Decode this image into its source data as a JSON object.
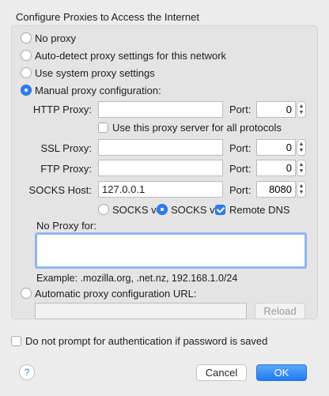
{
  "section_title": "Configure Proxies to Access the Internet",
  "options": {
    "no_proxy": "No proxy",
    "auto_detect": "Auto-detect proxy settings for this network",
    "system": "Use system proxy settings",
    "manual": "Manual proxy configuration:",
    "auto_url": "Automatic proxy configuration URL:"
  },
  "selected_option": "manual",
  "http": {
    "label": "HTTP Proxy:",
    "value": "",
    "port_label": "Port:",
    "port": "0"
  },
  "use_for_all": {
    "label": "Use this proxy server for all protocols",
    "checked": false
  },
  "ssl": {
    "label": "SSL Proxy:",
    "value": "",
    "port_label": "Port:",
    "port": "0"
  },
  "ftp": {
    "label": "FTP Proxy:",
    "value": "",
    "port_label": "Port:",
    "port": "0"
  },
  "socks": {
    "label": "SOCKS Host:",
    "value": "127.0.0.1",
    "port_label": "Port:",
    "port": "8080"
  },
  "socks_version": {
    "v4": "SOCKS v4",
    "v5": "SOCKS v5",
    "selected": "v5"
  },
  "remote_dns": {
    "label": "Remote DNS",
    "checked": true
  },
  "no_proxy_for": {
    "label": "No Proxy for:",
    "value": ""
  },
  "example": "Example: .mozilla.org, .net.nz, 192.168.1.0/24",
  "auto_url": {
    "value": "",
    "reload_label": "Reload"
  },
  "do_not_prompt": {
    "label": "Do not prompt for authentication if password is saved",
    "checked": false
  },
  "buttons": {
    "help": "?",
    "cancel": "Cancel",
    "ok": "OK"
  },
  "stepper_glyphs": {
    "up": "▲",
    "down": "▼"
  },
  "colors": {
    "accent": "#2f7df6",
    "focus_ring": "#8fb6f2"
  }
}
